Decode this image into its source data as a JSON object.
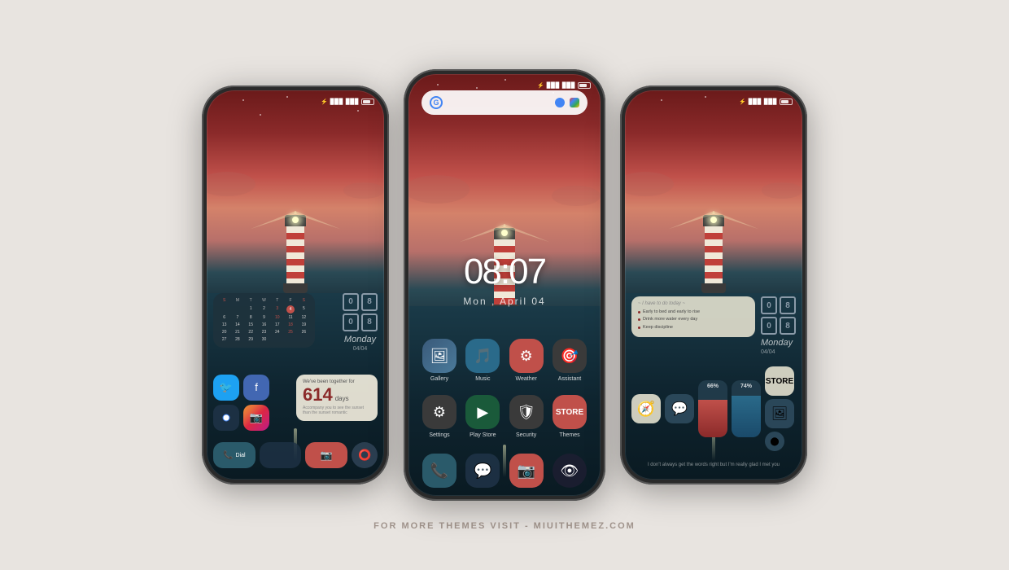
{
  "watermark": "FOR MORE THEMES VISIT - MIUITHEMEZ.COM",
  "phones": {
    "left": {
      "calendar": {
        "day_names": [
          "S",
          "M",
          "T",
          "W",
          "T",
          "F",
          "S"
        ],
        "days": [
          "",
          "",
          "1",
          "2",
          "3",
          "4",
          "5",
          "6",
          "7",
          "8",
          "9",
          "10",
          "11",
          "12",
          "13",
          "14",
          "15",
          "16",
          "17",
          "18",
          "19",
          "20",
          "21",
          "22",
          "23",
          "24",
          "25",
          "26",
          "27",
          "28",
          "29",
          "30"
        ]
      },
      "time_blocks": [
        "0",
        "8",
        "0",
        "8"
      ],
      "day_label": "Monday",
      "date_label": "04/04",
      "days_counter": {
        "prefix": "We've been together for",
        "number": "614",
        "suffix": "days",
        "subtitle": "Accompany you to see the sunset than the sunset romantic"
      },
      "social_apps": [
        "Twitter",
        "Facebook",
        "Chrome",
        "Instagram"
      ],
      "bottom_apps": [
        "Dial",
        "Camera"
      ]
    },
    "center": {
      "clock": "08:07",
      "date": "Mon ,    April    04",
      "app_rows": [
        [
          {
            "name": "Gallery",
            "label": "Gallery"
          },
          {
            "name": "Music",
            "label": "Music"
          },
          {
            "name": "Weather",
            "label": "Weather"
          },
          {
            "name": "Assistant",
            "label": "Assistant"
          }
        ],
        [
          {
            "name": "Settings",
            "label": "Settings"
          },
          {
            "name": "Play Store",
            "label": "Play Store"
          },
          {
            "name": "Security",
            "label": "Security"
          },
          {
            "name": "Themes",
            "label": "Themes"
          }
        ]
      ],
      "dock_apps": [
        "Phone",
        "Messages",
        "Camera",
        "Eye"
      ]
    },
    "right": {
      "todo": {
        "title": "~ I have to do today ~",
        "items": [
          "Early to bed and early to rise",
          "Drink more water every day",
          "Keep discipline"
        ]
      },
      "time_blocks": [
        "0",
        "8",
        "0",
        "8"
      ],
      "day_label": "Monday",
      "date_label": "04/04",
      "progress_widgets": [
        {
          "label": "66%",
          "value": 66
        },
        {
          "label": "74%",
          "value": 74
        }
      ],
      "quote": "I don't always get the words right but I'm really glad I met you"
    }
  }
}
